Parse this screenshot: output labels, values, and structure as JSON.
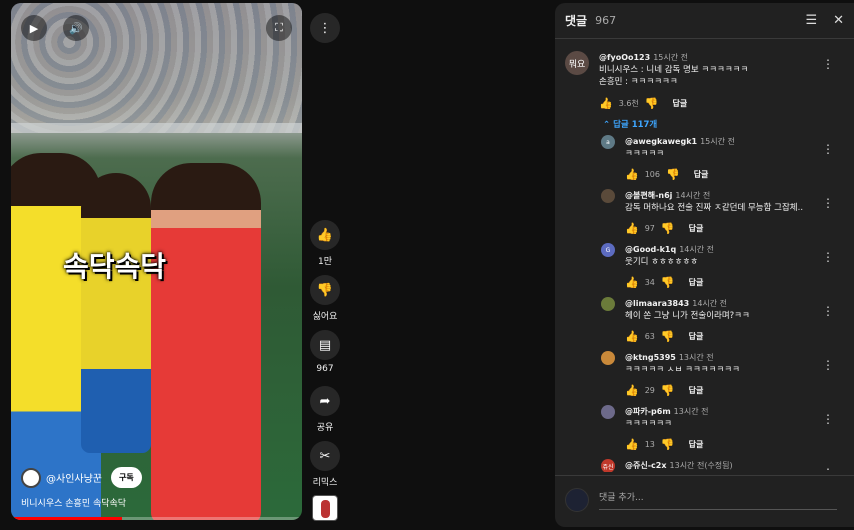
{
  "video": {
    "caption": "속닥속닥",
    "channel_name": "@사인사냥꾼",
    "subscribe_label": "구독",
    "title": "비니시우스 손흥민 속닥속닥",
    "progress": 0.38,
    "controls": {
      "play_icon": "play-icon",
      "volume_icon": "volume-icon",
      "fullscreen_icon": "fullscreen-icon"
    }
  },
  "side_actions": {
    "like_count": "1만",
    "dislike_label": "싫어요",
    "comment_count": "967",
    "share_label": "공유",
    "remix_label": "리믹스"
  },
  "comments_panel": {
    "title": "댓글",
    "count": "967",
    "reply_label": "답글",
    "replies_toggle": "답글 117개",
    "add_comment_placeholder": "댓글 추가...",
    "top_comment": {
      "avatar_text": "뭐요",
      "author": "@fyoOo123",
      "time": "15시간 전",
      "line1": "비니시우스 : 니네 감독 명보 ㅋㅋㅋㅋㅋㅋ",
      "line2": "손흥민 : ㅋㅋㅋㅋㅋㅋ",
      "likes": "3.6천"
    },
    "replies": [
      {
        "avatar_text": "a",
        "avatar_color": "#5f7a86",
        "author": "@awegkawegk1",
        "time": "15시간 전",
        "text": "ㅋㅋㅋㅋㅋ",
        "likes": "106"
      },
      {
        "avatar_text": "",
        "avatar_color": "#5a4a3a",
        "author": "@볼편해-n6j",
        "time": "14시간 전",
        "text": "감독 머하나요 전술 진짜 ㅈ같던데 무능함 그잡체..",
        "likes": "97"
      },
      {
        "avatar_text": "G",
        "avatar_color": "#5c6bc0",
        "author": "@Good-k1q",
        "time": "14시간 전",
        "text": "웃기디 ㅎㅎㅎㅎㅎㅎ",
        "likes": "34"
      },
      {
        "avatar_text": "",
        "avatar_color": "#6b7b3a",
        "author": "@limaara3843",
        "time": "14시간 전",
        "text": "헤이 쏜 그냥 니가 전술이라며?ㅋㅋ",
        "likes": "63"
      },
      {
        "avatar_text": "",
        "avatar_color": "#c9893a",
        "author": "@ktng5395",
        "time": "13시간 전",
        "text": "ㅋㅋㅋㅋㅋ ㅅㅂ ㅋㅋㅋㅋㅋㅋㅋ",
        "likes": "29"
      },
      {
        "avatar_text": "",
        "avatar_color": "#6d6a8a",
        "author": "@파카-p6m",
        "time": "13시간 전",
        "text": "ㅋㅋㅋㅋㅋㅋ",
        "likes": "13"
      },
      {
        "avatar_text": "쥬신",
        "avatar_color": "#c0392b",
        "author": "@쥬신-c2x",
        "time": "13시간 전(수정됨)",
        "text": "",
        "likes": ""
      }
    ]
  }
}
